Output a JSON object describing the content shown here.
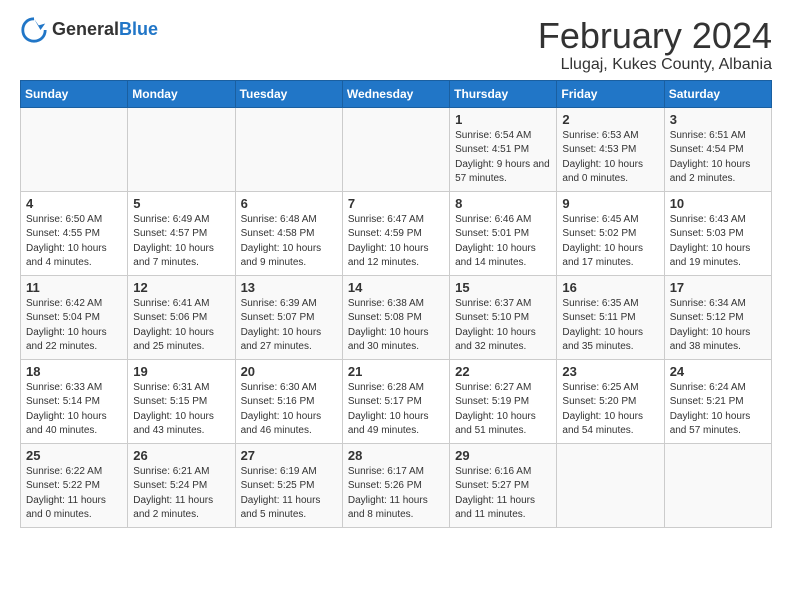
{
  "logo": {
    "general": "General",
    "blue": "Blue"
  },
  "title": "February 2024",
  "subtitle": "Llugaj, Kukes County, Albania",
  "days_of_week": [
    "Sunday",
    "Monday",
    "Tuesday",
    "Wednesday",
    "Thursday",
    "Friday",
    "Saturday"
  ],
  "weeks": [
    [
      {
        "day": "",
        "info": ""
      },
      {
        "day": "",
        "info": ""
      },
      {
        "day": "",
        "info": ""
      },
      {
        "day": "",
        "info": ""
      },
      {
        "day": "1",
        "info": "Sunrise: 6:54 AM\nSunset: 4:51 PM\nDaylight: 9 hours and 57 minutes."
      },
      {
        "day": "2",
        "info": "Sunrise: 6:53 AM\nSunset: 4:53 PM\nDaylight: 10 hours and 0 minutes."
      },
      {
        "day": "3",
        "info": "Sunrise: 6:51 AM\nSunset: 4:54 PM\nDaylight: 10 hours and 2 minutes."
      }
    ],
    [
      {
        "day": "4",
        "info": "Sunrise: 6:50 AM\nSunset: 4:55 PM\nDaylight: 10 hours and 4 minutes."
      },
      {
        "day": "5",
        "info": "Sunrise: 6:49 AM\nSunset: 4:57 PM\nDaylight: 10 hours and 7 minutes."
      },
      {
        "day": "6",
        "info": "Sunrise: 6:48 AM\nSunset: 4:58 PM\nDaylight: 10 hours and 9 minutes."
      },
      {
        "day": "7",
        "info": "Sunrise: 6:47 AM\nSunset: 4:59 PM\nDaylight: 10 hours and 12 minutes."
      },
      {
        "day": "8",
        "info": "Sunrise: 6:46 AM\nSunset: 5:01 PM\nDaylight: 10 hours and 14 minutes."
      },
      {
        "day": "9",
        "info": "Sunrise: 6:45 AM\nSunset: 5:02 PM\nDaylight: 10 hours and 17 minutes."
      },
      {
        "day": "10",
        "info": "Sunrise: 6:43 AM\nSunset: 5:03 PM\nDaylight: 10 hours and 19 minutes."
      }
    ],
    [
      {
        "day": "11",
        "info": "Sunrise: 6:42 AM\nSunset: 5:04 PM\nDaylight: 10 hours and 22 minutes."
      },
      {
        "day": "12",
        "info": "Sunrise: 6:41 AM\nSunset: 5:06 PM\nDaylight: 10 hours and 25 minutes."
      },
      {
        "day": "13",
        "info": "Sunrise: 6:39 AM\nSunset: 5:07 PM\nDaylight: 10 hours and 27 minutes."
      },
      {
        "day": "14",
        "info": "Sunrise: 6:38 AM\nSunset: 5:08 PM\nDaylight: 10 hours and 30 minutes."
      },
      {
        "day": "15",
        "info": "Sunrise: 6:37 AM\nSunset: 5:10 PM\nDaylight: 10 hours and 32 minutes."
      },
      {
        "day": "16",
        "info": "Sunrise: 6:35 AM\nSunset: 5:11 PM\nDaylight: 10 hours and 35 minutes."
      },
      {
        "day": "17",
        "info": "Sunrise: 6:34 AM\nSunset: 5:12 PM\nDaylight: 10 hours and 38 minutes."
      }
    ],
    [
      {
        "day": "18",
        "info": "Sunrise: 6:33 AM\nSunset: 5:14 PM\nDaylight: 10 hours and 40 minutes."
      },
      {
        "day": "19",
        "info": "Sunrise: 6:31 AM\nSunset: 5:15 PM\nDaylight: 10 hours and 43 minutes."
      },
      {
        "day": "20",
        "info": "Sunrise: 6:30 AM\nSunset: 5:16 PM\nDaylight: 10 hours and 46 minutes."
      },
      {
        "day": "21",
        "info": "Sunrise: 6:28 AM\nSunset: 5:17 PM\nDaylight: 10 hours and 49 minutes."
      },
      {
        "day": "22",
        "info": "Sunrise: 6:27 AM\nSunset: 5:19 PM\nDaylight: 10 hours and 51 minutes."
      },
      {
        "day": "23",
        "info": "Sunrise: 6:25 AM\nSunset: 5:20 PM\nDaylight: 10 hours and 54 minutes."
      },
      {
        "day": "24",
        "info": "Sunrise: 6:24 AM\nSunset: 5:21 PM\nDaylight: 10 hours and 57 minutes."
      }
    ],
    [
      {
        "day": "25",
        "info": "Sunrise: 6:22 AM\nSunset: 5:22 PM\nDaylight: 11 hours and 0 minutes."
      },
      {
        "day": "26",
        "info": "Sunrise: 6:21 AM\nSunset: 5:24 PM\nDaylight: 11 hours and 2 minutes."
      },
      {
        "day": "27",
        "info": "Sunrise: 6:19 AM\nSunset: 5:25 PM\nDaylight: 11 hours and 5 minutes."
      },
      {
        "day": "28",
        "info": "Sunrise: 6:17 AM\nSunset: 5:26 PM\nDaylight: 11 hours and 8 minutes."
      },
      {
        "day": "29",
        "info": "Sunrise: 6:16 AM\nSunset: 5:27 PM\nDaylight: 11 hours and 11 minutes."
      },
      {
        "day": "",
        "info": ""
      },
      {
        "day": "",
        "info": ""
      }
    ]
  ]
}
